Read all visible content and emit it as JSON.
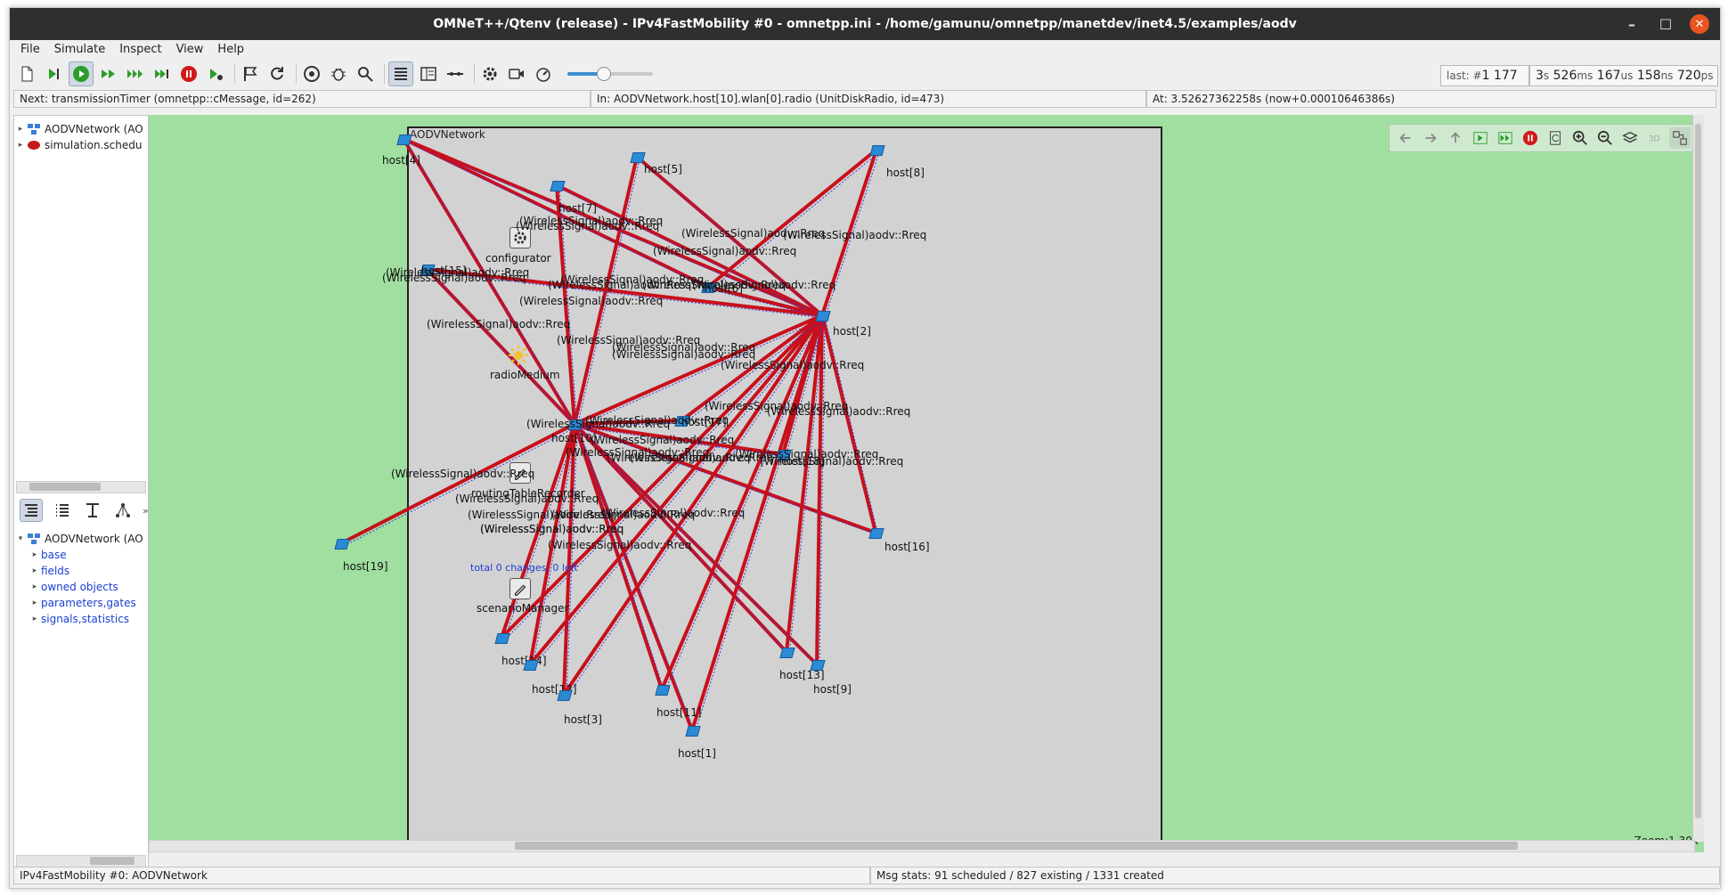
{
  "window": {
    "title": "OMNeT++/Qtenv (release) - IPv4FastMobility #0 - omnetpp.ini - /home/gamunu/omnetpp/manetdev/inet4.5/examples/aodv",
    "min": "–",
    "max": "☐",
    "close": "✕"
  },
  "menu": [
    "File",
    "Simulate",
    "Inspect",
    "View",
    "Help"
  ],
  "counters": {
    "last_label": "last: #",
    "last_value": "1 177",
    "time_s": "3",
    "time_s_unit": "s",
    "time_ms": "526",
    "time_ms_unit": "ms",
    "time_us": "167",
    "time_us_unit": "us",
    "time_ns": "158",
    "time_ns_unit": "ns",
    "time_ps": "720",
    "time_ps_unit": "ps"
  },
  "speed_slider": {
    "value_fraction": 0.42
  },
  "info": {
    "next": "Next: transmissionTimer (omnetpp::cMessage, id=262)",
    "in": "In: AODVNetwork.host[10].wlan[0].radio (UnitDiskRadio, id=473)",
    "at": "At: 3.52627362258s (now+0.00010646386s)"
  },
  "object_tree": [
    {
      "label": "AODVNetwork (AO",
      "icon": "network-icon"
    },
    {
      "label": "simulation.schedu",
      "icon": "scheduler-icon"
    }
  ],
  "inspector_tree": {
    "root": "AODVNetwork (AO",
    "children": [
      "base",
      "fields",
      "owned objects",
      "parameters,gates",
      "signals,statistics"
    ]
  },
  "network": {
    "title": "AODVNetwork",
    "modules": {
      "configurator": "configurator",
      "radioMedium": "radioMedium",
      "routingTableRecorder": "routingTableRecorder",
      "scenarioManager": "scenarioManager",
      "scenario_note": "total 0 changes, 0 left"
    },
    "hosts": [
      "host[4]",
      "host[5]",
      "host[7]",
      "host[8]",
      "host[2]",
      "host[18]",
      "host[16]",
      "host[19]",
      "host[14]",
      "host[12]",
      "host[3]",
      "host[13]",
      "host[9]",
      "host[1]",
      "host[11]",
      "host[10]",
      "host[17]",
      "host[6]",
      "host[15]"
    ],
    "signal_label": "(WirelessSignal)aodv::Rreq"
  },
  "zoom": "Zoom:1.30x",
  "status": {
    "left": "IPv4FastMobility #0: AODVNetwork",
    "right": "Msg stats: 91 scheduled / 827 existing / 1331 created"
  }
}
